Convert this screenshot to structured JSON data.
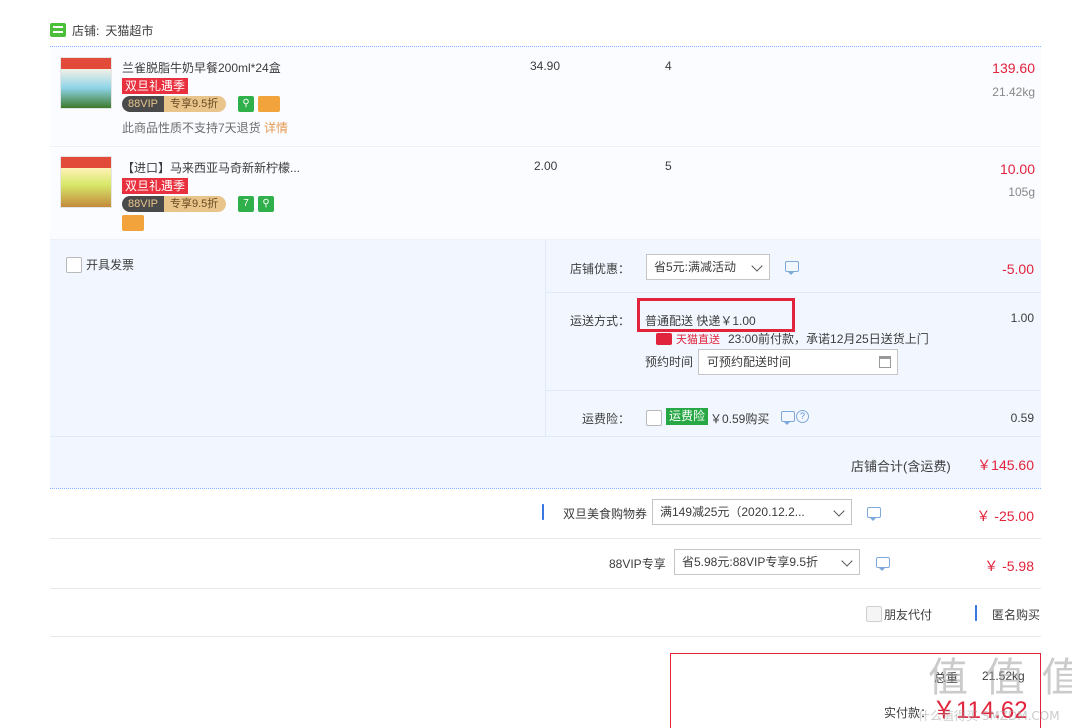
{
  "shop": {
    "label": "店铺:",
    "name": "天猫超市"
  },
  "items": [
    {
      "title": "兰雀脱脂牛奶早餐200ml*24盒",
      "promo_tag": "双旦礼遇季",
      "vip_a": "88VIP",
      "vip_b": "专享9.5折",
      "note": "此商品性质不支持7天退货",
      "note_link": "详情",
      "unit_price": "34.90",
      "quantity": "4",
      "subtotal": "139.60",
      "weight": "21.42kg"
    },
    {
      "title": "【进口】马来西亚马奇新新柠檬...",
      "promo_tag": "双旦礼遇季",
      "vip_a": "88VIP",
      "vip_b": "专享9.5折",
      "badge_seven": "7",
      "unit_price": "2.00",
      "quantity": "5",
      "subtotal": "10.00",
      "weight": "105g"
    }
  ],
  "invoice": {
    "label": "开具发票"
  },
  "store_discount": {
    "label": "店铺优惠：",
    "select": "省5元:满减活动",
    "amount": "-5.00"
  },
  "shipping": {
    "label": "运送方式：",
    "method": "普通配送 快递￥1.00",
    "tmall_tag": "天猫直送",
    "promise": "23:00前付款，承诺12月25日送货上门",
    "reserve_label": "预约时间",
    "reserve_placeholder": "可预约配送时间",
    "amount": "1.00"
  },
  "insurance": {
    "label": "运费险：",
    "tag": "运费险",
    "price": "￥0.59购买",
    "amount": "0.59"
  },
  "store_total": {
    "label": "店铺合计(含运费)",
    "amount": "￥145.60"
  },
  "coupon": {
    "label": "双旦美食购物券",
    "select": "满149减25元（2020.12.2...",
    "amount": "￥ -25.00"
  },
  "vip_discount": {
    "label": "88VIP专享",
    "select": "省5.98元:88VIP专享9.5折",
    "amount": "￥ -5.98"
  },
  "friend_pay": {
    "label": "朋友代付"
  },
  "anonymous": {
    "label": "匿名购买"
  },
  "summary": {
    "weight_label": "总重",
    "weight_value": "21.52kg",
    "pay_label": "实付款：",
    "pay_amount": "￥114.62"
  },
  "watermark": {
    "line1": "值 值 值",
    "line2": "什么值得买 SMZDM.COM"
  },
  "colors": {
    "accent_red": "#e2233c",
    "panel_bg": "#f2f7ff",
    "checkbox_blue": "#3a76e0",
    "tmall_green": "#4bbf3a"
  }
}
